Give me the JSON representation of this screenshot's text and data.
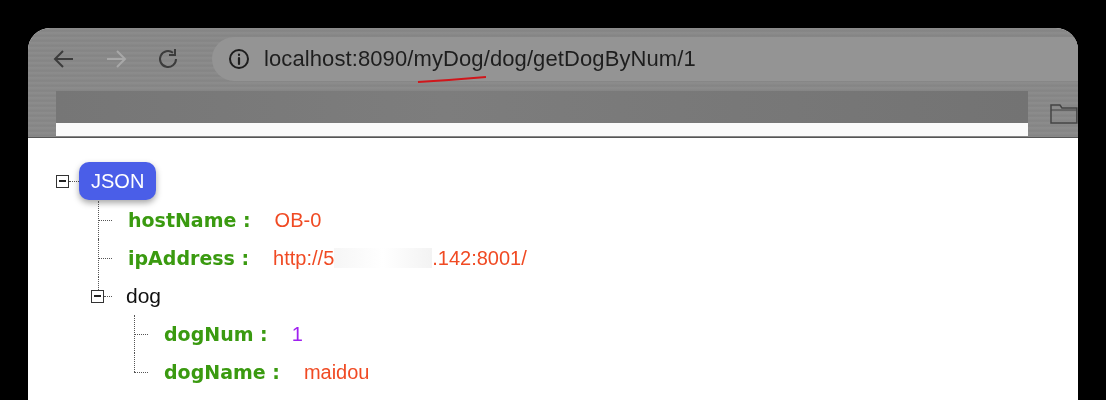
{
  "browser": {
    "nav_buttons": [
      {
        "kind": "back",
        "disabled": false
      },
      {
        "kind": "forward",
        "disabled": true
      },
      {
        "kind": "reload",
        "disabled": false
      }
    ],
    "address": "localhost:8090/myDog/dog/getDogByNum/1"
  },
  "json_tree": {
    "label": "JSON",
    "expanded": true,
    "children": [
      {
        "kind": "pair",
        "key": "hostName :",
        "color": "#f04a23",
        "value_parts": [
          "OB-0"
        ]
      },
      {
        "kind": "pair",
        "key": "ipAddress :",
        "color": "#f04a23",
        "value_parts": [
          "http://5",
          ".142:8001/"
        ]
      },
      {
        "kind": "object",
        "key": "dog",
        "expanded": true,
        "children": [
          {
            "kind": "pair",
            "key": "dogNum :",
            "color": "#a020f0",
            "value_parts": [
              "1"
            ]
          },
          {
            "kind": "pair",
            "key": "dogName :",
            "color": "#f04a23",
            "value_parts": [
              "maidou"
            ]
          }
        ]
      }
    ]
  }
}
